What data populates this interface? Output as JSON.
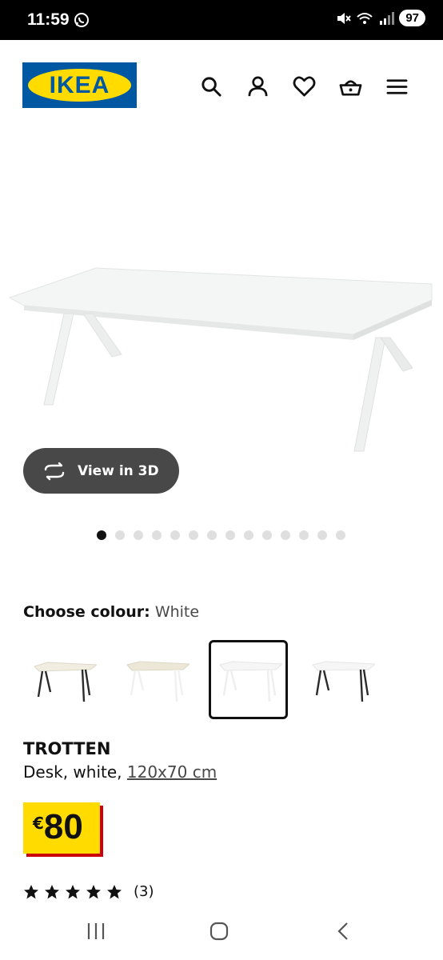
{
  "status_bar": {
    "time": "11:59",
    "battery": "97",
    "icons": [
      "whatsapp-icon",
      "mute-icon",
      "wifi-icon",
      "signal-icon"
    ]
  },
  "header": {
    "logo_text": "IKEA",
    "icons": [
      "search-icon",
      "account-icon",
      "wishlist-heart-icon",
      "basket-icon",
      "menu-icon"
    ],
    "brand_blue": "#0058a3",
    "brand_yellow": "#ffdb00"
  },
  "gallery": {
    "view_3d_label": "View in 3D",
    "image_count": 14,
    "active_index": 0
  },
  "colour": {
    "label": "Choose colour:",
    "value": "White",
    "swatches": [
      {
        "name": "beige-black",
        "selected": false
      },
      {
        "name": "beige-white",
        "selected": false
      },
      {
        "name": "white",
        "selected": true
      },
      {
        "name": "white-anthracite",
        "selected": false
      }
    ]
  },
  "product": {
    "name": "TROTTEN",
    "description": "Desk, white,",
    "dimensions": "120x70 cm",
    "currency": "€",
    "price": "80",
    "rating_stars": 5,
    "rating_count": "(3)"
  },
  "navbar": {
    "icons": [
      "recent-apps-icon",
      "home-icon",
      "back-icon"
    ]
  }
}
